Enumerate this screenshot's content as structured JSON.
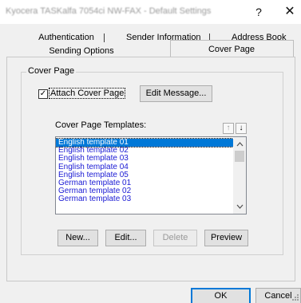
{
  "window": {
    "title": "Kyocera TASKalfa 7054ci NW-FAX - Default Settings",
    "help_glyph": "?",
    "close_glyph": "✕"
  },
  "tabs": {
    "authentication": "Authentication",
    "sender_information": "Sender Information",
    "address_book": "Address Book",
    "sending_options": "Sending Options",
    "cover_page": "Cover Page"
  },
  "cover_page": {
    "group_label": "Cover Page",
    "attach_cover_page_label": "Attach Cover Page",
    "attach_cover_page_checked": true,
    "check_glyph": "✓",
    "edit_message_label": "Edit Message...",
    "templates_label": "Cover Page Templates:",
    "move_up_glyph": "↑",
    "move_down_glyph": "↓",
    "templates": [
      "English template 01",
      "English template 02",
      "English template 03",
      "English template 04",
      "English template 05",
      "German template 01",
      "German template 02",
      "German template 03"
    ],
    "selected_index": 0,
    "new_label": "New...",
    "edit_label": "Edit...",
    "delete_label": "Delete",
    "preview_label": "Preview"
  },
  "footer": {
    "ok_label": "OK",
    "cancel_label": "Cancel"
  },
  "icons": {
    "scroll_up": "chevron-up-icon",
    "scroll_down": "chevron-down-icon",
    "resize": "resize-grip-icon"
  }
}
